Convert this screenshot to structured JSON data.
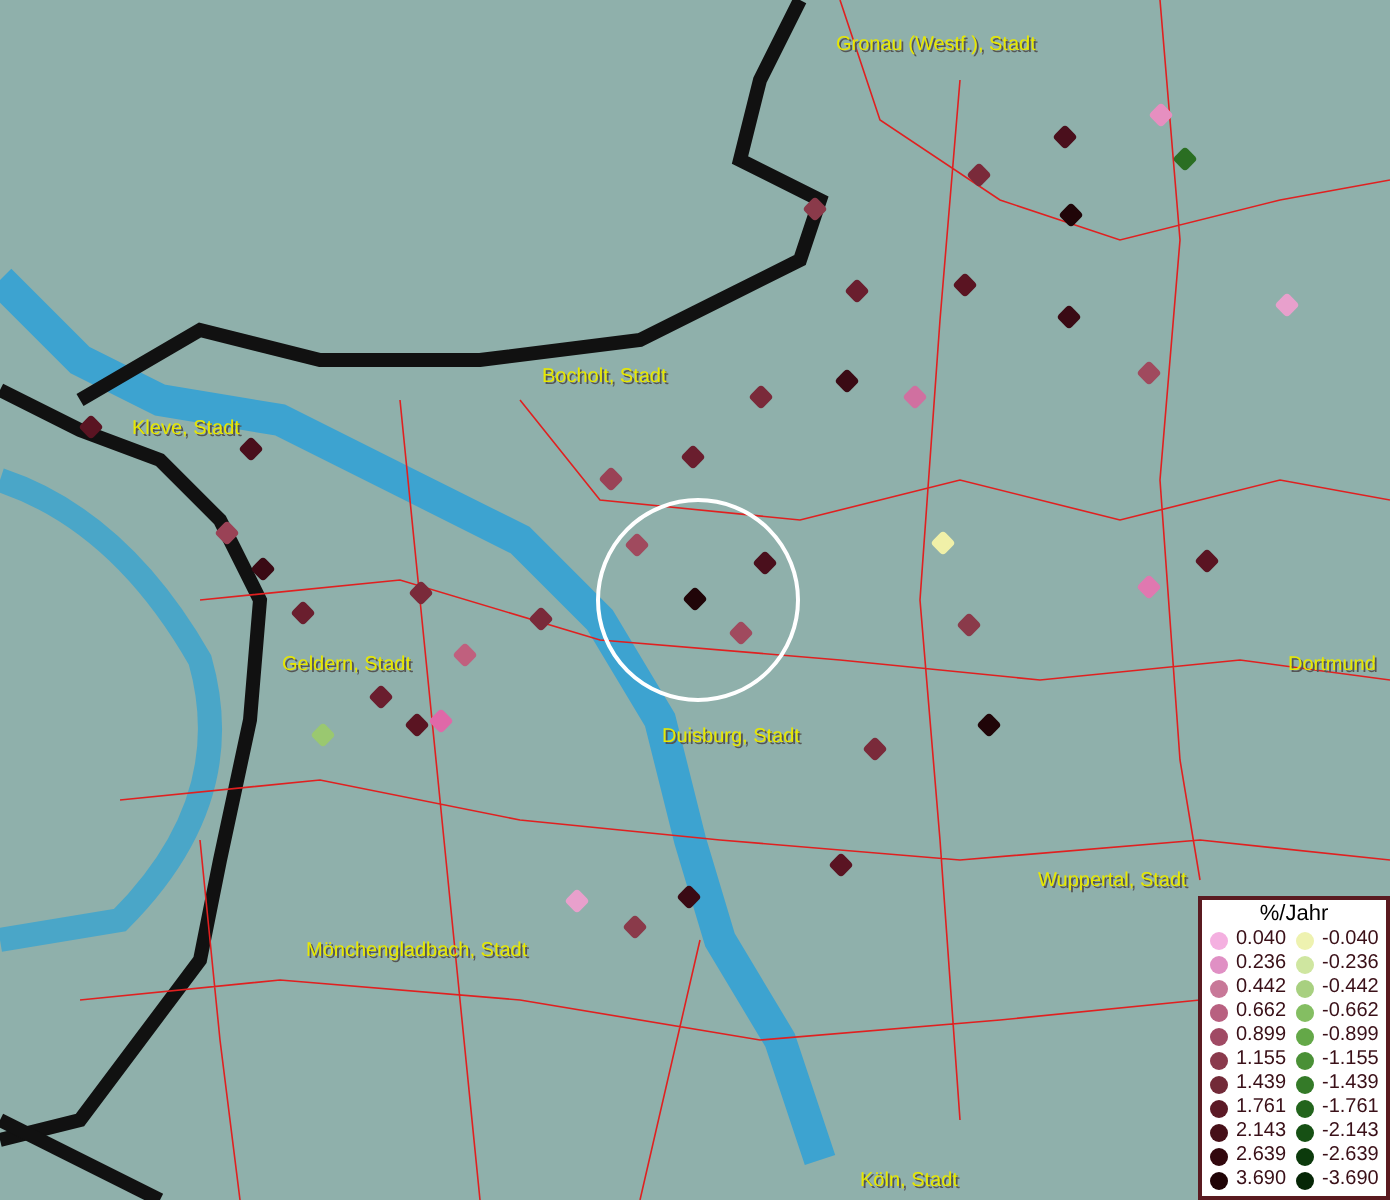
{
  "map": {
    "cities": [
      {
        "name": "Gronau (Westf.), Stadt"
      },
      {
        "name": "Bocholt, Stadt"
      },
      {
        "name": "Kleve, Stadt"
      },
      {
        "name": "Geldern, Stadt"
      },
      {
        "name": "Duisburg, Stadt"
      },
      {
        "name": "Dortmund"
      },
      {
        "name": "Wuppertal, Stadt"
      },
      {
        "name": "Mönchengladbach, Stadt"
      },
      {
        "name": "Köln, Stadt"
      }
    ],
    "markers": [
      {
        "color": "#4a0f1c"
      },
      {
        "color": "#7a2a3a"
      },
      {
        "color": "#2a6e22"
      },
      {
        "color": "#200508"
      },
      {
        "color": "#e68fc0"
      },
      {
        "color": "#8a3a4a"
      },
      {
        "color": "#6a1e2e"
      },
      {
        "color": "#5a1422"
      },
      {
        "color": "#e8a0cc"
      },
      {
        "color": "#3a0a14"
      },
      {
        "color": "#a04a5e"
      },
      {
        "color": "#d070a0"
      },
      {
        "color": "#3a0a14"
      },
      {
        "color": "#7a2a3a"
      },
      {
        "color": "#9a4256"
      },
      {
        "color": "#6a1e2e"
      },
      {
        "color": "#f0f0a8"
      },
      {
        "color": "#e078b0"
      },
      {
        "color": "#5a1422"
      },
      {
        "color": "#8a3a4a"
      },
      {
        "color": "#a04a5e"
      },
      {
        "color": "#4a0f1c"
      },
      {
        "color": "#200508"
      },
      {
        "color": "#9ac870"
      },
      {
        "color": "#7a2a3a"
      },
      {
        "color": "#c0607e"
      },
      {
        "color": "#6a1e2e"
      },
      {
        "color": "#5a1422"
      },
      {
        "color": "#e8a0cc"
      },
      {
        "color": "#8a3a4a"
      },
      {
        "color": "#3a0a14"
      },
      {
        "color": "#a04a5e"
      },
      {
        "color": "#5a1422"
      },
      {
        "color": "#7a2a3a"
      },
      {
        "color": "#200508"
      },
      {
        "color": "#e068a8"
      },
      {
        "color": "#6a1e2e"
      },
      {
        "color": "#4a0f1c"
      },
      {
        "color": "#9a4256"
      },
      {
        "color": "#3a0a14"
      },
      {
        "color": "#7a2a3a"
      },
      {
        "color": "#5a1422"
      }
    ],
    "legend": {
      "title": "%/Jahr",
      "entries": [
        {
          "value": "0.040",
          "color": "#f4b0e0"
        },
        {
          "value": "-0.040",
          "color": "#eef2b0"
        },
        {
          "value": "0.236",
          "color": "#e090c4"
        },
        {
          "value": "-0.236",
          "color": "#cfe6a0"
        },
        {
          "value": "0.442",
          "color": "#c87898"
        },
        {
          "value": "-0.442",
          "color": "#a8d080"
        },
        {
          "value": "0.662",
          "color": "#b86080"
        },
        {
          "value": "-0.662",
          "color": "#84be62"
        },
        {
          "value": "0.899",
          "color": "#a04a64"
        },
        {
          "value": "-0.899",
          "color": "#64a848"
        },
        {
          "value": "1.155",
          "color": "#8a3a4c"
        },
        {
          "value": "-1.155",
          "color": "#4a9036"
        },
        {
          "value": "1.439",
          "color": "#722a38"
        },
        {
          "value": "-1.439",
          "color": "#347a28"
        },
        {
          "value": "1.761",
          "color": "#5c1a26"
        },
        {
          "value": "-1.761",
          "color": "#22641c"
        },
        {
          "value": "2.143",
          "color": "#461018"
        },
        {
          "value": "-2.143",
          "color": "#165014"
        },
        {
          "value": "2.639",
          "color": "#32080e"
        },
        {
          "value": "-2.639",
          "color": "#0c3a0c"
        },
        {
          "value": "3.690",
          "color": "#200406"
        },
        {
          "value": "-3.690",
          "color": "#062606"
        }
      ]
    }
  }
}
